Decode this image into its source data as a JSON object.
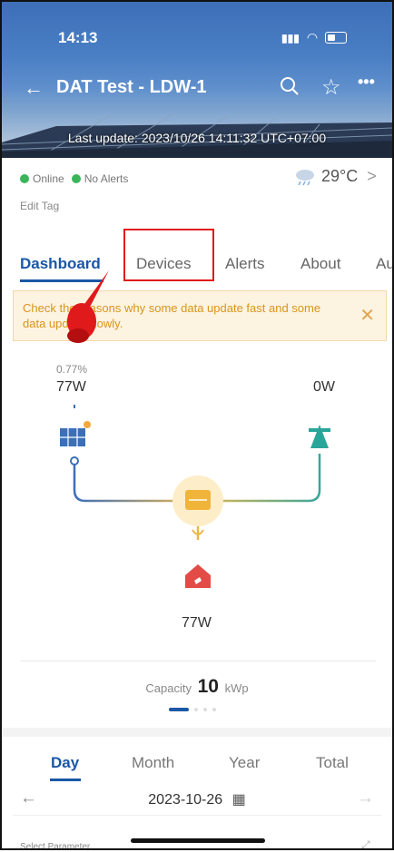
{
  "status_bar": {
    "time": "14:13",
    "signal": "📶",
    "wifi": "wifi"
  },
  "header": {
    "back_icon": "←",
    "title": "DAT Test - LDW-1",
    "search_icon": "⌕",
    "star_icon": "☆",
    "more_icon": "•••",
    "last_update": "Last update: 2023/10/26 14:11:32 UTC+07:00"
  },
  "info": {
    "online": "Online",
    "alerts": "No Alerts",
    "edit_tag": "Edit Tag",
    "weather_temp": "29°C",
    "weather_chevron": ">"
  },
  "tabs": [
    "Dashboard",
    "Devices",
    "Alerts",
    "About",
    "Au"
  ],
  "notice": {
    "text": "Check the reasons why some data update fast and some data update slowly.",
    "close": "✕"
  },
  "energy_flow": {
    "pv_percent": "0.77%",
    "pv_power": "77W",
    "grid_power": "0W",
    "load_power": "77W"
  },
  "capacity": {
    "label": "Capacity",
    "value": "10",
    "unit": "kWp"
  },
  "period_tabs": [
    "Day",
    "Month",
    "Year",
    "Total"
  ],
  "date_nav": {
    "prev": "←",
    "date": "2023-10-26",
    "calendar_icon": "▦",
    "next": "→"
  },
  "bottom": {
    "partial_text": "Select Parameter",
    "expand_icon": "⤢"
  },
  "colors": {
    "accent": "#1a57a6",
    "warning_text": "#d9951b",
    "highlight": "#e0191b",
    "online": "#3bb55a"
  }
}
